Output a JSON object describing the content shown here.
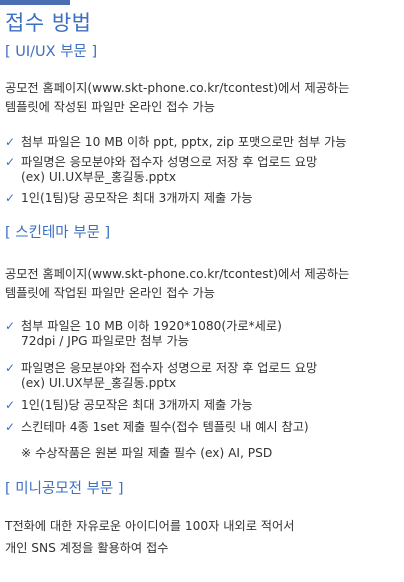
{
  "colors": {
    "accent": "#3d6fc2",
    "text": "#333333",
    "bar": "#4a6fb3"
  },
  "page": {
    "title": "접수 방법",
    "sections": [
      {
        "heading": "[ UI/UX 부문 ]",
        "intro": [
          "공모전 홈페이지(www.skt-phone.co.kr/tcontest)에서 제공하는",
          "템플릿에 작성된 파일만 온라인 접수 가능"
        ],
        "items": [
          [
            "첨부 파일은 10 MB 이하 ppt, pptx, zip 포맷으로만 첨부 가능"
          ],
          [
            "파일명은 응모분야와 접수자 성명으로 저장 후 업로드 요망",
            "(ex) UI.UX부문_홍길동.pptx"
          ],
          [
            "1인(1팀)당 공모작은 최대 3개까지 제출 가능"
          ]
        ]
      },
      {
        "heading": "[ 스킨테마 부문 ]",
        "intro": [
          "공모전 홈페이지(www.skt-phone.co.kr/tcontest)에서 제공하는",
          "템플릿에 작업된 파일만 온라인 접수 가능"
        ],
        "items": [
          [
            "첨부 파일은 10 MB 이하 1920*1080(가로*세로)",
            "72dpi / JPG 파일로만 첨부 가능"
          ],
          [
            "파일명은 응모분야와 접수자 성명으로 저장 후 업로드 요망",
            "(ex) UI.UX부문_홍길동.pptx"
          ],
          [
            "1인(1팀)당 공모작은 최대 3개까지 제출 가능"
          ],
          [
            "스킨테마 4종 1set 제출 필수(접수 템플릿 내 예시 참고)"
          ]
        ],
        "note": "※ 수상작품은 원본 파일 제출 필수 (ex) AI, PSD"
      },
      {
        "heading": "[ 미니공모전 부문 ]",
        "intro": [
          "T전화에 대한 자유로운 아이디어를 100자 내외로 적어서",
          "개인 SNS 계정을 활용하여 접수"
        ]
      }
    ]
  }
}
